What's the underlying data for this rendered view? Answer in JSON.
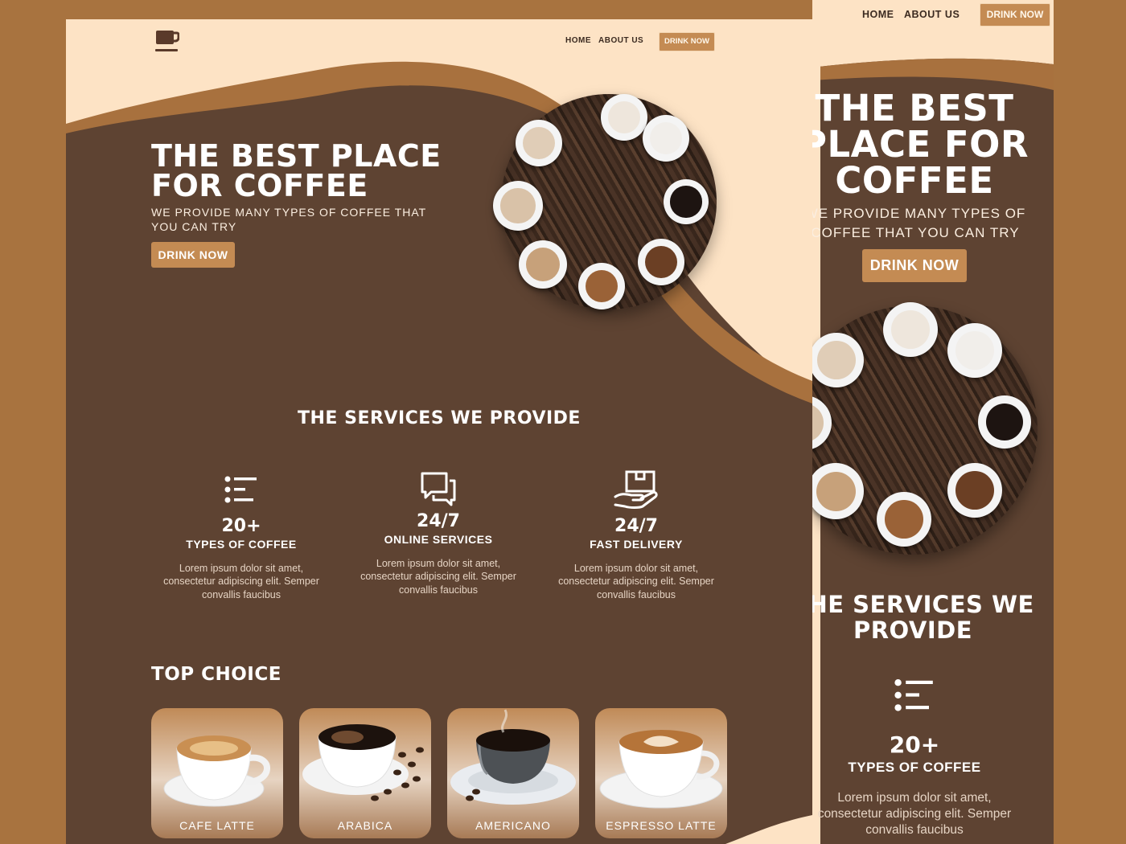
{
  "colors": {
    "background": "#a8733f",
    "cream": "#fde3c5",
    "brown": "#5e4332",
    "caramel": "#a8713e",
    "button": "#c48b53",
    "logo": "#5a3a2a"
  },
  "nav": {
    "logo_icon": "coffee-cup-icon",
    "home": "HOME",
    "about": "ABOUT US",
    "cta": "DRINK NOW"
  },
  "hero": {
    "title_line1": "THE BEST PLACE",
    "title_line2": "FOR COFFEE",
    "subtitle_line1": "WE PROVIDE MANY TYPES OF COFFEE THAT",
    "subtitle_line2": "YOU CAN TRY",
    "button": "DRINK NOW"
  },
  "services": {
    "title": "THE SERVICES WE PROVIDE",
    "items": [
      {
        "icon": "list-icon",
        "number": "20+",
        "label": "TYPES OF COFFEE",
        "desc_line1": "Lorem ipsum dolor sit amet,",
        "desc_line2": "consectetur adipiscing elit. Semper",
        "desc_line3": "convallis faucibus"
      },
      {
        "icon": "chat-icon",
        "number": "24/7",
        "label": "ONLINE SERVICES",
        "desc_line1": "Lorem ipsum dolor sit amet,",
        "desc_line2": "consectetur adipiscing elit. Semper",
        "desc_line3": "convallis faucibus"
      },
      {
        "icon": "delivery-hand-icon",
        "number": "24/7",
        "label": "FAST DELIVERY",
        "desc_line1": "Lorem ipsum dolor sit amet,",
        "desc_line2": "consectetur adipiscing elit. Semper",
        "desc_line3": "convallis faucibus"
      }
    ]
  },
  "top_choice": {
    "title": "TOP CHOICE",
    "items": [
      {
        "label": "CAFE LATTE"
      },
      {
        "label": "ARABICA"
      },
      {
        "label": "AMERICANO"
      },
      {
        "label": "ESPRESSO LATTE"
      }
    ]
  },
  "mobile": {
    "nav": {
      "home": "HOME",
      "about": "ABOUT US",
      "cta": "DRINK NOW"
    },
    "hero": {
      "title_line1": "THE BEST",
      "title_line2": "PLACE FOR",
      "title_line3": "COFFEE",
      "subtitle_line1": "WE PROVIDE MANY TYPES OF",
      "subtitle_line2": "COFFEE THAT YOU CAN TRY",
      "button": "DRINK NOW"
    },
    "services": {
      "title_line1": "THE SERVICES WE",
      "title_line2": "PROVIDE",
      "number": "20+",
      "label": "TYPES OF COFFEE",
      "desc_line1": "Lorem ipsum dolor sit amet,",
      "desc_line2": "consectetur adipiscing elit. Semper",
      "desc_line3": "convallis faucibus"
    }
  }
}
